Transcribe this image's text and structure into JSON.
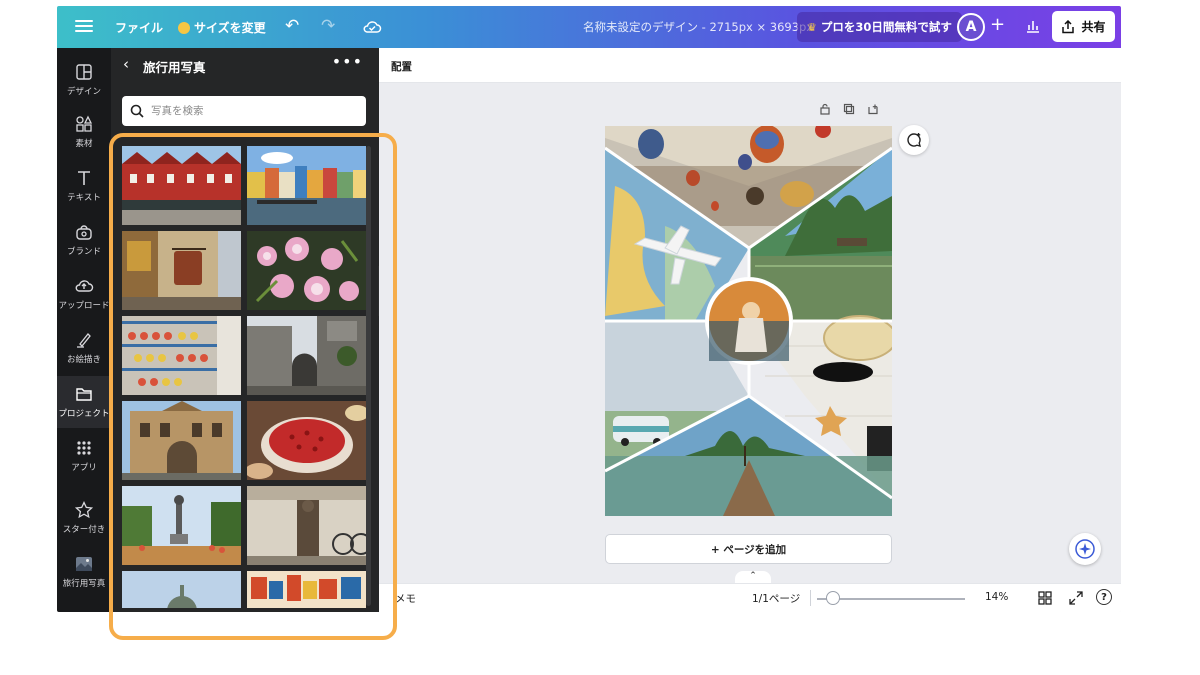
{
  "topbar": {
    "file_label": "ファイル",
    "resize_label": "サイズを変更",
    "doc_title": "名称未設定のデザイン - 2715px × 3693px",
    "pro_label": "プロを30日間無料で試す",
    "avatar_initial": "A",
    "share_label": "共有"
  },
  "rail": {
    "items": [
      {
        "label": "デザイン",
        "icon": "layout-icon"
      },
      {
        "label": "素材",
        "icon": "shapes-icon"
      },
      {
        "label": "テキスト",
        "icon": "text-icon"
      },
      {
        "label": "ブランド",
        "icon": "brand-icon"
      },
      {
        "label": "アップロード",
        "icon": "upload-icon"
      },
      {
        "label": "お絵描き",
        "icon": "draw-icon"
      },
      {
        "label": "プロジェクト",
        "icon": "folder-icon"
      },
      {
        "label": "アプリ",
        "icon": "apps-icon"
      },
      {
        "label": "スター付き",
        "icon": "star-icon"
      },
      {
        "label": "旅行用写真",
        "icon": "photo-thumb-icon"
      }
    ],
    "active_index": 6
  },
  "panel": {
    "title": "旅行用写真",
    "search_placeholder": "写真を検索"
  },
  "subbar": {
    "label": "配置"
  },
  "canvas": {
    "add_page_label": "+ ページを追加"
  },
  "bottombar": {
    "notes_label": "メモ",
    "pages_label": "1/1ページ",
    "zoom_label": "14%",
    "zoom_level": 0.14,
    "help_label": "?"
  },
  "colors": {
    "accent_highlight": "#f6ad4a",
    "topbar_start": "#3dbfc9",
    "topbar_end": "#7a3fe6",
    "rail_bg": "#18191b",
    "panel_bg": "#252627"
  }
}
